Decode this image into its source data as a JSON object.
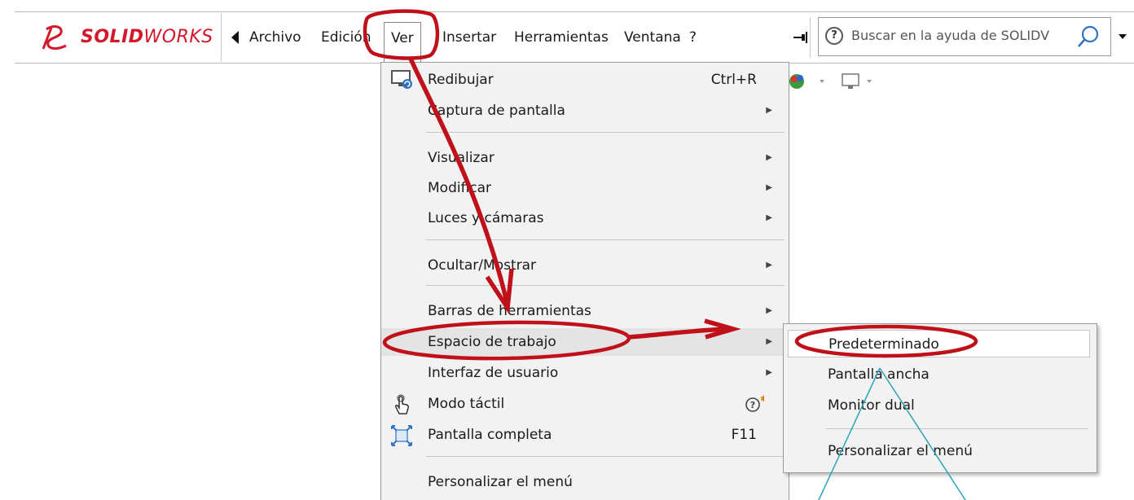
{
  "app": {
    "logo_ds": "DS",
    "logo_solid": "SOLID",
    "logo_works": "WORKS"
  },
  "menubar": {
    "items": [
      {
        "label": "Archivo"
      },
      {
        "label": "Edición"
      },
      {
        "label": "Ver"
      },
      {
        "label": "Insertar"
      },
      {
        "label": "Herramientas"
      },
      {
        "label": "Ventana"
      },
      {
        "label": "?"
      }
    ],
    "active": "Ver"
  },
  "search": {
    "placeholder": "Buscar en la ayuda de SOLIDV"
  },
  "ver_menu": {
    "items": [
      {
        "label": "Redibujar",
        "shortcut": "Ctrl+R"
      },
      {
        "label": "Captura de pantalla"
      },
      {
        "label": "Visualizar"
      },
      {
        "label": "Modificar"
      },
      {
        "label": "Luces y cámaras"
      },
      {
        "label": "Ocultar/Mostrar"
      },
      {
        "label": "Barras de herramientas"
      },
      {
        "label": "Espacio de trabajo"
      },
      {
        "label": "Interfaz de usuario"
      },
      {
        "label": "Modo táctil"
      },
      {
        "label": "Pantalla completa",
        "shortcut": "F11"
      },
      {
        "label": "Personalizar el menú"
      }
    ],
    "highlighted": "Espacio de trabajo"
  },
  "workspace_submenu": {
    "items": [
      {
        "label": "Predeterminado"
      },
      {
        "label": "Pantalla ancha"
      },
      {
        "label": "Monitor dual"
      },
      {
        "label": "Personalizar el menú"
      }
    ],
    "highlighted": "Predeterminado"
  },
  "colors": {
    "brand_red": "#d3182b",
    "annotation_red": "#c0101a",
    "annotation_cyan": "#2aa3b8",
    "menu_bg": "#f2f2f2"
  }
}
